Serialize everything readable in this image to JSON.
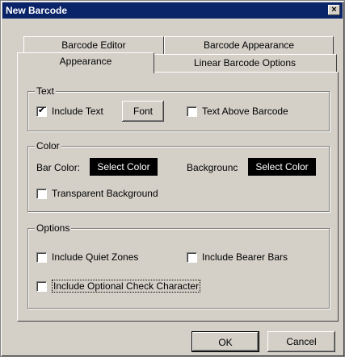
{
  "window": {
    "title": "New Barcode",
    "close_glyph": "×"
  },
  "tabs": {
    "row1": [
      "Barcode Editor",
      "Barcode Appearance"
    ],
    "row2": [
      "Appearance",
      "Linear Barcode Options"
    ],
    "active": "Appearance"
  },
  "text_group": {
    "legend": "Text",
    "include_text": {
      "label": "Include Text",
      "checked": true
    },
    "font_button": "Font",
    "text_above": {
      "label": "Text Above Barcode",
      "checked": false
    }
  },
  "color_group": {
    "legend": "Color",
    "bar_color_label": "Bar Color:",
    "bar_color_button": "Select Color",
    "background_label": "Backgrounc",
    "background_button": "Select Color",
    "transparent": {
      "label": "Transparent Background",
      "checked": false
    }
  },
  "options_group": {
    "legend": "Options",
    "quiet_zones": {
      "label": "Include Quiet Zones",
      "checked": false
    },
    "bearer_bars": {
      "label": "Include Bearer Bars",
      "checked": false
    },
    "check_char": {
      "label": "Include Optional Check Character",
      "checked": false
    }
  },
  "footer": {
    "ok": "OK",
    "cancel": "Cancel"
  }
}
